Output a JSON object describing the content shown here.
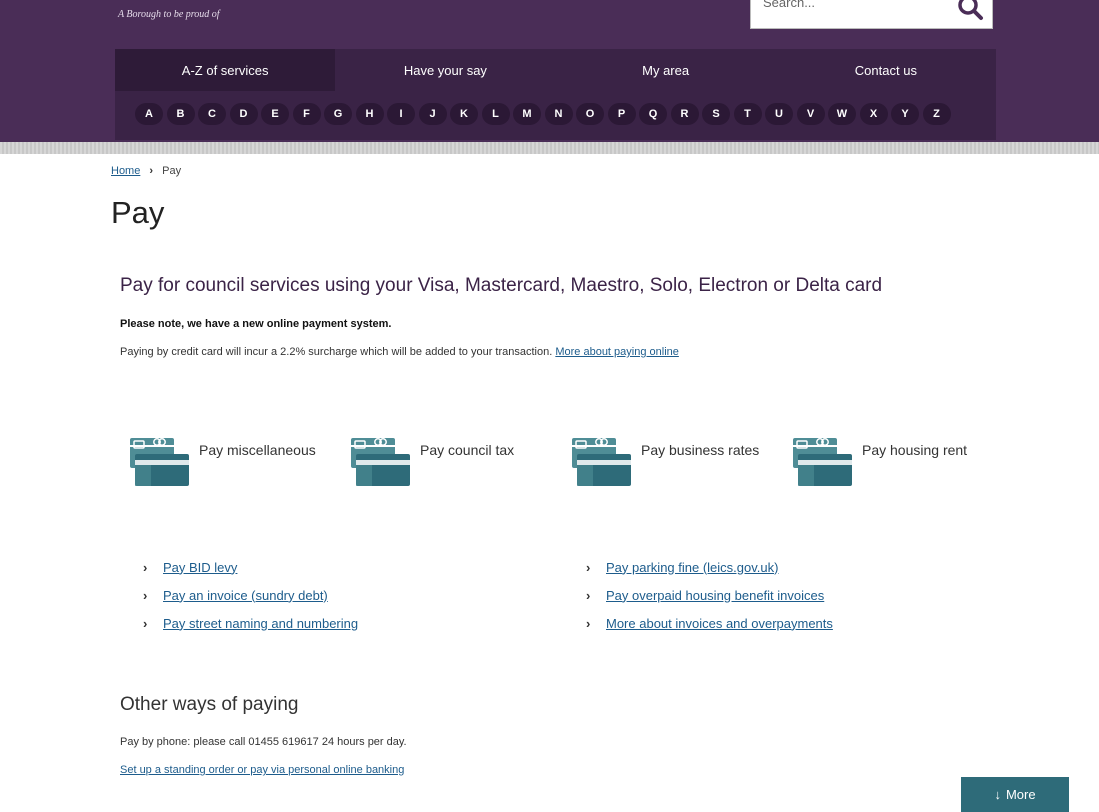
{
  "header": {
    "tagline": "A Borough to be proud of",
    "search": {
      "placeholder": "Search..."
    },
    "brand_color": "#4a2d57"
  },
  "nav": {
    "tabs": [
      {
        "label": "A-Z of services"
      },
      {
        "label": "Have your say"
      },
      {
        "label": "My area"
      },
      {
        "label": "Contact us"
      }
    ],
    "az_letters": [
      "A",
      "B",
      "C",
      "D",
      "E",
      "F",
      "G",
      "H",
      "I",
      "J",
      "K",
      "L",
      "M",
      "N",
      "O",
      "P",
      "Q",
      "R",
      "S",
      "T",
      "U",
      "V",
      "W",
      "X",
      "Y",
      "Z"
    ]
  },
  "breadcrumb": {
    "home": "Home",
    "current": "Pay"
  },
  "page": {
    "title": "Pay",
    "heading": "Pay for council services using your Visa, Mastercard, Maestro, Solo, Electron or Delta card",
    "note_bold": "Please note, we have a new online payment system.",
    "note_text": "Paying by credit card will incur a 2.2% surcharge which will be added to your transaction.",
    "note_link": "More about paying online"
  },
  "pay_tiles": [
    {
      "label": "Pay miscellaneous",
      "icon": "payment-card-icon"
    },
    {
      "label": "Pay council tax",
      "icon": "payment-card-icon"
    },
    {
      "label": "Pay business rates",
      "icon": "payment-card-icon"
    },
    {
      "label": "Pay housing rent",
      "icon": "payment-card-icon"
    }
  ],
  "links_left": [
    "Pay BID levy",
    "Pay an invoice (sundry debt)",
    "Pay street naming and numbering"
  ],
  "links_right": [
    "Pay parking fine (leics.gov.uk)",
    "Pay overpaid housing benefit invoices",
    "More about invoices and overpayments"
  ],
  "other": {
    "heading": "Other ways of paying",
    "phone": "Pay by phone: please call 01455 619617 24 hours per day.",
    "standing_order": "Set up a standing order or pay via personal online banking"
  },
  "more_button": {
    "label": "More"
  }
}
